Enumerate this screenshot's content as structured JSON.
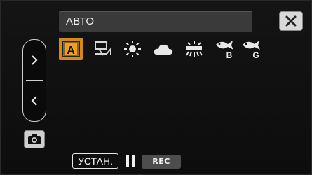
{
  "header": {
    "mode_title": "АВТО",
    "close_icon": "close-x-icon"
  },
  "sidebar": {
    "next_icon": "chevron-right-icon",
    "prev_icon": "chevron-left-icon",
    "camera_icon": "camera-icon"
  },
  "white_balance": {
    "selected": "auto",
    "options": [
      {
        "id": "auto",
        "label": "A",
        "icon": "auto-wb-icon"
      },
      {
        "id": "manual",
        "icon": "manual-wb-icon"
      },
      {
        "id": "sunny",
        "icon": "sun-icon"
      },
      {
        "id": "cloudy",
        "icon": "cloud-icon"
      },
      {
        "id": "fluorescent",
        "icon": "fluorescent-icon"
      },
      {
        "id": "underwater_blue",
        "label": "B",
        "icon": "fish-b-icon"
      },
      {
        "id": "underwater_green",
        "label": "G",
        "icon": "fish-g-icon"
      }
    ]
  },
  "footer": {
    "set_label": "УСТАН.",
    "pause_icon": "pause-icon",
    "rec_label": "REC"
  },
  "colors": {
    "selection_accent": "#d08a1e",
    "title_bar_bg": "#3a3a3a",
    "rec_bg": "#4d4d4d"
  }
}
